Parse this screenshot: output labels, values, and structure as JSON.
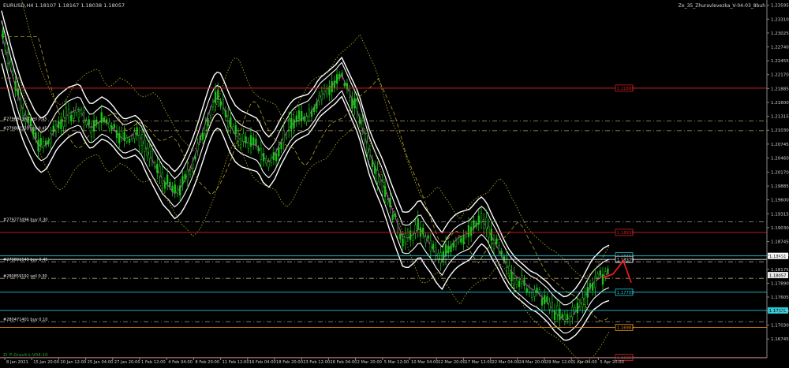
{
  "chart_header": {
    "symbol_info": "EURUSD,H4  1.18107 1.18167 1.18038 1.18057",
    "ea_label": "Ze_35_Zhuravlevezka_V-04-03_8buh"
  },
  "indicator_label": "Zi_P-Gravit-L-V04-10",
  "chart_data": {
    "type": "line",
    "title": "",
    "xlabel": "",
    "ylabel": "",
    "ylim": [
      1.1636,
      1.2367
    ],
    "y_ticks": [
      "1.23595",
      "1.23310",
      "1.23025",
      "1.22740",
      "1.22455",
      "1.22170",
      "1.21885",
      "1.21600",
      "1.21315",
      "1.21030",
      "1.20745",
      "1.20460",
      "1.20170",
      "1.19885",
      "1.19600",
      "1.19315",
      "1.19030",
      "1.18745",
      "1.18460",
      "1.18175",
      "1.17890",
      "1.17605",
      "1.17320",
      "1.17030",
      "1.16745"
    ],
    "y_tick_values": [
      1.23595,
      1.2331,
      1.23025,
      1.2274,
      1.22455,
      1.2217,
      1.21885,
      1.216,
      1.21315,
      1.2103,
      1.20745,
      1.2046,
      1.2017,
      1.19885,
      1.196,
      1.19315,
      1.1903,
      1.18745,
      1.1846,
      1.18175,
      1.1789,
      1.17605,
      1.1732,
      1.1703,
      1.16745
    ],
    "x_ticks": [
      "8 Jan 2021",
      "15 Jan 20:00",
      "20 Jan 12:00",
      "25 Jan 04:00",
      "27 Jan 20:00",
      "1 Feb 12:00",
      "4 Feb 04:00",
      "8 Feb 20:00",
      "11 Feb 12:00",
      "16 Feb 04:00",
      "18 Feb 20:00",
      "23 Feb 12:00",
      "26 Feb 04:00",
      "2 Mar 20:00",
      "5 Mar 12:00",
      "10 Mar 04:00",
      "12 Mar 20:00",
      "17 Mar 12:00",
      "22 Mar 04:00",
      "24 Mar 20:00",
      "29 Mar 12:00",
      "1 Apr 04:00",
      "5 Apr 20:00"
    ],
    "x_count": 240,
    "price_series": [
      1.23,
      1.2255,
      1.221,
      1.217,
      1.2135,
      1.211,
      1.2085,
      1.207,
      1.2075,
      1.2095,
      1.2115,
      1.2125,
      1.2135,
      1.214,
      1.2145,
      1.212,
      1.2105,
      1.2115,
      1.2125,
      1.212,
      1.211,
      1.2095,
      1.2085,
      1.209,
      1.2095,
      1.2085,
      1.206,
      1.204,
      1.202,
      1.2,
      1.199,
      1.1975,
      1.1985,
      1.2005,
      1.203,
      1.206,
      1.2095,
      1.213,
      1.216,
      1.217,
      1.2145,
      1.2115,
      1.2095,
      1.2085,
      1.208,
      1.2075,
      1.207,
      1.2045,
      1.2035,
      1.205,
      1.2075,
      1.2095,
      1.2115,
      1.2125,
      1.213,
      1.2135,
      1.215,
      1.217,
      1.218,
      1.219,
      1.22,
      1.2215,
      1.219,
      1.2165,
      1.214,
      1.21,
      1.206,
      1.203,
      1.2005,
      1.1975,
      1.194,
      1.191,
      1.188,
      1.188,
      1.189,
      1.1905,
      1.1885,
      1.187,
      1.185,
      1.1835,
      1.1855,
      1.187,
      1.188,
      1.1885,
      1.189,
      1.1905,
      1.192,
      1.191,
      1.1885,
      1.1865,
      1.184,
      1.182,
      1.1805,
      1.1795,
      1.1785,
      1.1775,
      1.177,
      1.176,
      1.175,
      1.1735,
      1.1725,
      1.1715,
      1.172,
      1.173,
      1.1745,
      1.1765,
      1.1785,
      1.1795,
      1.1805,
      1.181
    ],
    "price_x_range": [
      0,
      239
    ],
    "horizontal_levels": [
      {
        "name": "level-red-1",
        "value": 1.21893,
        "label": "1.21893",
        "color": "#d02020",
        "box": true
      },
      {
        "name": "level-red-2",
        "value": 1.18933,
        "label": "1.18933",
        "color": "#d02020",
        "box": true
      },
      {
        "name": "level-cyan-1",
        "value": 1.18452,
        "label": "1.18452",
        "color": "#1fc7d4",
        "box": true
      },
      {
        "name": "level-cyan-2",
        "value": 1.17705,
        "label": "1.17705",
        "color": "#1fc7d4",
        "box": true
      },
      {
        "name": "level-cyan-3",
        "value": 1.17331,
        "label": "1.17331",
        "color": "#1fc7d4",
        "box": false
      },
      {
        "name": "level-orange-1",
        "value": 1.16983,
        "label": "1.16983",
        "color": "#d98a1a",
        "box": true
      },
      {
        "name": "level-red-3",
        "value": 1.16367,
        "label": "1.16367",
        "color": "#d02020",
        "box": true
      },
      {
        "name": "level-white-1",
        "value": 1.18379,
        "label": "1.18379",
        "color": "#e0e0e0",
        "box": true
      }
    ],
    "dashed_levels": [
      {
        "name": "dash-sell-1",
        "value": 1.2122,
        "label": "#279694387 sell 0.45",
        "color": "#b0a060"
      },
      {
        "name": "dash-sell-2",
        "value": 1.2102,
        "label": "#279881539 sell 0.45",
        "color": "#b0a060"
      },
      {
        "name": "dash-buy-1",
        "value": 1.1915,
        "label": "#279273496 buy 0.30",
        "color": "#a0a0a0"
      },
      {
        "name": "dash-buy-2",
        "value": 1.1833,
        "label": "#279891549 buy 0.45",
        "color": "#a0a0a0"
      },
      {
        "name": "dash-sell-3",
        "value": 1.1799,
        "label": "#280859192 sell 0.30",
        "color": "#b0a060"
      },
      {
        "name": "dash-buy-3",
        "value": 1.171,
        "label": "#280471401 buy 0.10",
        "color": "#a0a0a0"
      }
    ],
    "current_price": {
      "value": 1.18057,
      "label": "1.18057"
    },
    "bid_box": {
      "value": 1.18451,
      "label": "1.18451"
    }
  }
}
